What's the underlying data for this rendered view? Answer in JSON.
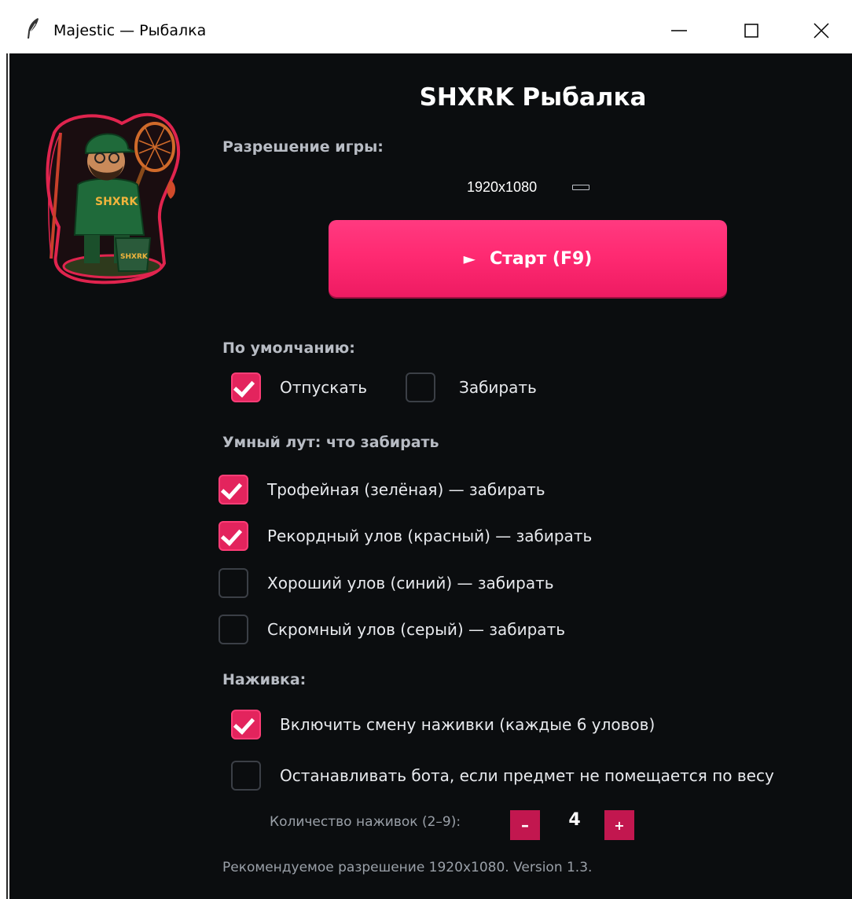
{
  "window": {
    "title": "Majestic — Рыбалка",
    "minimize_label": "minimize",
    "maximize_label": "maximize",
    "close_label": "close"
  },
  "app": {
    "title": "SHXRK Рыбалка",
    "logo_text": "SHXRK"
  },
  "resolution": {
    "heading": "Разрешение игры:",
    "value": "1920x1080"
  },
  "start_button": {
    "label": "Старт (F9)"
  },
  "default_action": {
    "heading": "По умолчанию:",
    "options": [
      {
        "label": "Отпускать",
        "checked": true
      },
      {
        "label": "Забирать",
        "checked": false
      }
    ]
  },
  "smart_loot": {
    "heading": "Умный лут: что забирать",
    "items": [
      {
        "label": "Трофейная (зелёная) — забирать",
        "checked": true
      },
      {
        "label": "Рекордный улов (красный) — забирать",
        "checked": true
      },
      {
        "label": "Хороший улов (синий) — забирать",
        "checked": false
      },
      {
        "label": "Скромный улов (серый) — забирать",
        "checked": false
      }
    ]
  },
  "bait": {
    "heading": "Наживка:",
    "options": [
      {
        "label": "Включить смену наживки (каждые 6 уловов)",
        "checked": true
      },
      {
        "label": "Останавливать бота, если предмет не помещается по весу",
        "checked": false
      }
    ],
    "count_label": "Количество наживок (2–9):",
    "count_value": "4",
    "minus_label": "–",
    "plus_label": "+"
  },
  "footer": {
    "text": "Рекомендуемое разрешение 1920x1080. Version 1.3."
  },
  "colors": {
    "accent": "#e3245d",
    "background": "#0b0d0f",
    "text": "#e8eaee",
    "muted": "#9aa0a8"
  }
}
